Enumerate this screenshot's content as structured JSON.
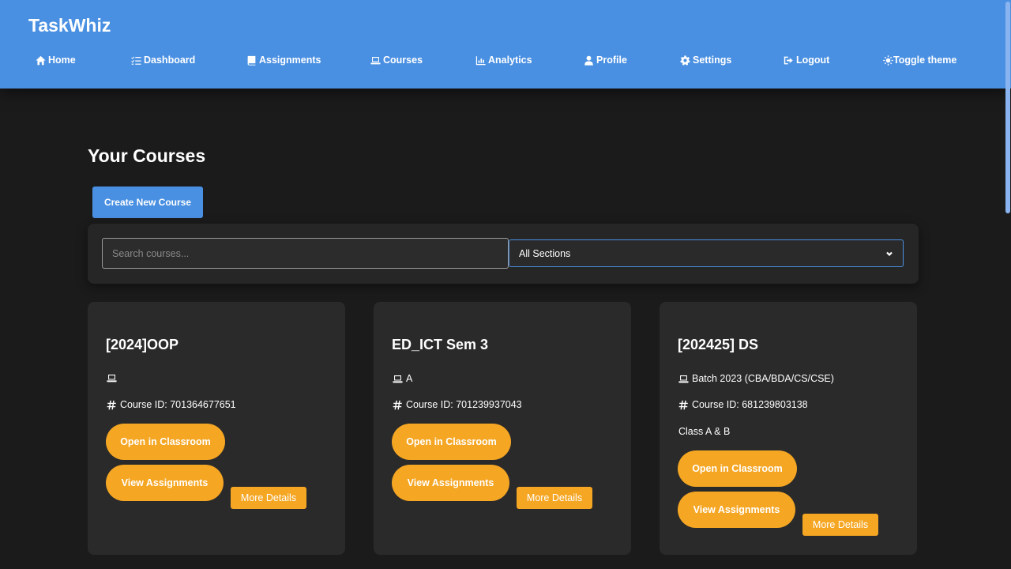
{
  "app": {
    "title": "TaskWhiz"
  },
  "nav": [
    {
      "label": "Home",
      "icon": "home-icon"
    },
    {
      "label": "Dashboard",
      "icon": "list-check-icon"
    },
    {
      "label": "Assignments",
      "icon": "book-icon"
    },
    {
      "label": "Courses",
      "icon": "laptop-icon"
    },
    {
      "label": "Analytics",
      "icon": "chart-bar-icon"
    },
    {
      "label": "Profile",
      "icon": "user-icon"
    },
    {
      "label": "Settings",
      "icon": "gear-icon"
    },
    {
      "label": "Logout",
      "icon": "logout-icon"
    },
    {
      "label": "Toggle theme",
      "icon": "sun-icon"
    }
  ],
  "page": {
    "title": "Your Courses",
    "create_label": "Create New Course"
  },
  "filters": {
    "search_placeholder": "Search courses...",
    "section_selected": "All Sections"
  },
  "courses": [
    {
      "title": "[2024]OOP",
      "section": "",
      "course_id": "Course ID: 701364677651",
      "note": "",
      "open_label": "Open in Classroom",
      "assign_label": "View Assignments",
      "details_label": "More Details"
    },
    {
      "title": "ED_ICT Sem 3",
      "section": "A",
      "course_id": "Course ID: 701239937043",
      "note": "",
      "open_label": "Open in Classroom",
      "assign_label": "View Assignments",
      "details_label": "More Details"
    },
    {
      "title": "[202425] DS",
      "section": "Batch 2023 (CBA/BDA/CS/CSE)",
      "course_id": "Course ID: 681239803138",
      "note": "Class A & B",
      "open_label": "Open in Classroom",
      "assign_label": "View Assignments",
      "details_label": "More Details"
    }
  ],
  "colors": {
    "header": "#4a90e2",
    "accent_button": "#f5a623",
    "card": "#2a2a2a",
    "background": "#1b1b1b"
  }
}
